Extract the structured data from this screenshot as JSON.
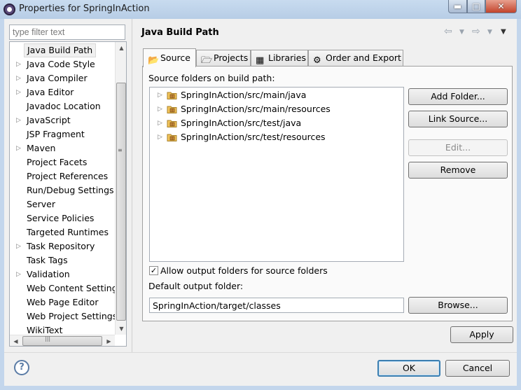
{
  "window": {
    "title": "Properties for SpringInAction",
    "controls": {
      "minimize": "▬",
      "maximize": "□",
      "close": "✕"
    }
  },
  "sidebar": {
    "filter_placeholder": "type filter text",
    "items": [
      {
        "label": "Java Build Path",
        "expandable": false,
        "selected": true
      },
      {
        "label": "Java Code Style",
        "expandable": true
      },
      {
        "label": "Java Compiler",
        "expandable": true
      },
      {
        "label": "Java Editor",
        "expandable": true
      },
      {
        "label": "Javadoc Location",
        "expandable": false
      },
      {
        "label": "JavaScript",
        "expandable": true
      },
      {
        "label": "JSP Fragment",
        "expandable": false
      },
      {
        "label": "Maven",
        "expandable": true
      },
      {
        "label": "Project Facets",
        "expandable": false
      },
      {
        "label": "Project References",
        "expandable": false
      },
      {
        "label": "Run/Debug Settings",
        "expandable": false
      },
      {
        "label": "Server",
        "expandable": false
      },
      {
        "label": "Service Policies",
        "expandable": false
      },
      {
        "label": "Targeted Runtimes",
        "expandable": false
      },
      {
        "label": "Task Repository",
        "expandable": true
      },
      {
        "label": "Task Tags",
        "expandable": false
      },
      {
        "label": "Validation",
        "expandable": true
      },
      {
        "label": "Web Content Settings",
        "expandable": false
      },
      {
        "label": "Web Page Editor",
        "expandable": false
      },
      {
        "label": "Web Project Settings",
        "expandable": false
      },
      {
        "label": "WikiText",
        "expandable": false
      }
    ]
  },
  "main": {
    "title": "Java Build Path",
    "tabs": [
      {
        "label": "Source",
        "icon": "source-folder-icon",
        "active": true
      },
      {
        "label": "Projects",
        "icon": "project-icon"
      },
      {
        "label": "Libraries",
        "icon": "library-icon"
      },
      {
        "label": "Order and Export",
        "icon": "order-export-icon"
      }
    ],
    "source_label": "Source folders on build path:",
    "source_folders": [
      "SpringInAction/src/main/java",
      "SpringInAction/src/main/resources",
      "SpringInAction/src/test/java",
      "SpringInAction/src/test/resources"
    ],
    "buttons": {
      "add_folder": "Add Folder...",
      "link_source": "Link Source...",
      "edit": "Edit...",
      "remove": "Remove",
      "browse": "Browse..."
    },
    "allow_output_label": "Allow output folders for source folders",
    "allow_output_checked": true,
    "default_output_label": "Default output folder:",
    "default_output_value": "SpringInAction/target/classes"
  },
  "footer": {
    "apply": "Apply",
    "ok": "OK",
    "cancel": "Cancel",
    "help": "?"
  }
}
